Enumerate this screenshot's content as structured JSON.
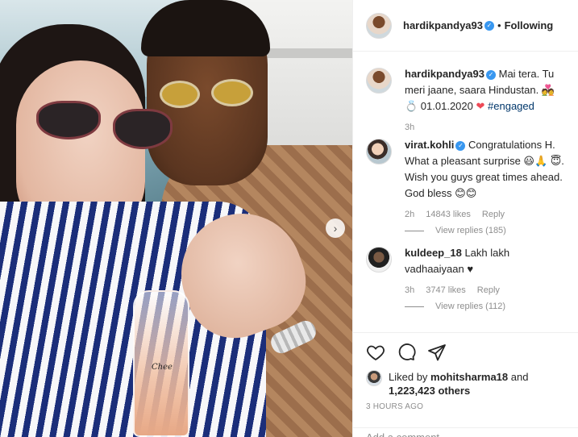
{
  "header": {
    "username": "hardikpandya93",
    "separator": "•",
    "follow_status": "Following"
  },
  "caption": {
    "username": "hardikpandya93",
    "text": "Mai tera. Tu meri jaane, saara Hindustan. 💑💍 01.01.2020",
    "heart": "❤",
    "hashtag": "#engaged",
    "time": "3h"
  },
  "comments": [
    {
      "username": "virat.kohli",
      "text": "Congratulations H. What a pleasant surprise 😃🙏 😇. Wish you guys great times ahead. God bless 😊😊",
      "time": "2h",
      "likes": "14843 likes",
      "reply": "Reply",
      "view_replies": "View replies (185)"
    },
    {
      "username": "kuldeep_18",
      "text": "Lakh lakh vadhaaiyaan ♥",
      "time": "3h",
      "likes": "3747 likes",
      "reply": "Reply",
      "view_replies": "View replies (112)"
    }
  ],
  "likes": {
    "prefix": "Liked by",
    "user": "mohitsharma18",
    "and": "and",
    "others": "1,223,423 others"
  },
  "posted_time": "3 HOURS AGO",
  "add_comment_placeholder": "Add a comment…",
  "photo": {
    "glass_text": "Chee"
  },
  "icons": {
    "like": "heart-icon",
    "comment": "comment-icon",
    "share": "share-icon",
    "next": "chevron-right-icon",
    "verified": "verified-badge-icon"
  },
  "colors": {
    "verified": "#3897f0",
    "hashtag": "#00376b",
    "heart": "#ed4956",
    "muted": "#8e8e8e"
  }
}
